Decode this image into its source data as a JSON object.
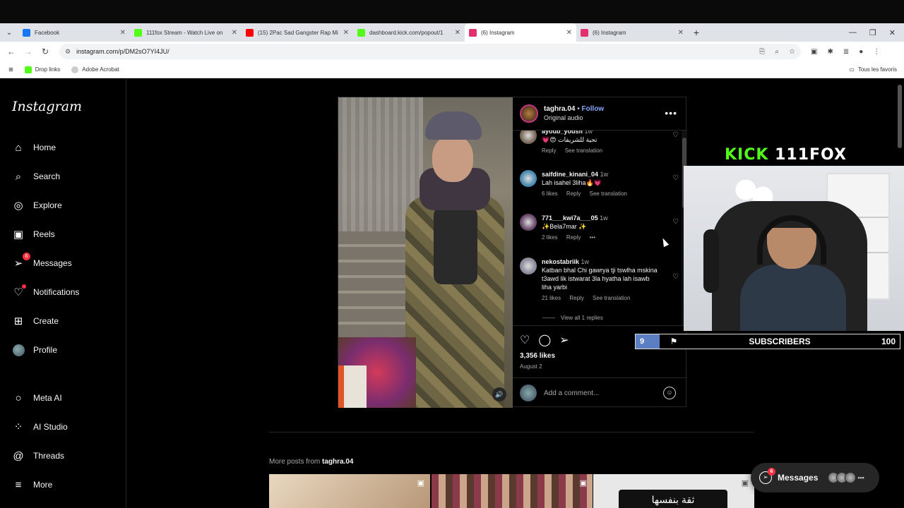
{
  "browser": {
    "tabs": [
      {
        "title": "Facebook",
        "color": "#1877f2",
        "active": false
      },
      {
        "title": "111fox Stream - Watch Live on",
        "color": "#53fc18",
        "active": false
      },
      {
        "title": "(15) 2Pac Sad Gangster Rap Mi",
        "color": "#ff0000",
        "active": false
      },
      {
        "title": "dashboard.kick.com/popout/1",
        "color": "#53fc18",
        "active": false
      },
      {
        "title": "(6) Instagram",
        "color": "#e1306c",
        "active": true
      },
      {
        "title": "(6) Instagram",
        "color": "#e1306c",
        "active": false
      }
    ],
    "url": "instagram.com/p/DM2sO7YI4JU/",
    "bookmarks": [
      {
        "label": "Drop links",
        "color": "#53fc18"
      },
      {
        "label": "Adobe Acrobat",
        "color": "#d9534f"
      }
    ],
    "all_bookmarks": "Tous les favoris"
  },
  "sidebar": {
    "logo": "Instagram",
    "items": [
      {
        "label": "Home",
        "icon": "⌂"
      },
      {
        "label": "Search",
        "icon": "⌕"
      },
      {
        "label": "Explore",
        "icon": "◎"
      },
      {
        "label": "Reels",
        "icon": "▣"
      },
      {
        "label": "Messages",
        "icon": "➢",
        "badge": "6"
      },
      {
        "label": "Notifications",
        "icon": "♡"
      },
      {
        "label": "Create",
        "icon": "⊞"
      },
      {
        "label": "Profile",
        "icon": ""
      },
      {
        "label": "Meta AI",
        "icon": "○"
      },
      {
        "label": "AI Studio",
        "icon": "⁘"
      },
      {
        "label": "Threads",
        "icon": "@"
      },
      {
        "label": "More",
        "icon": "≡"
      }
    ]
  },
  "post": {
    "username": "taghra.04",
    "follow": "Follow",
    "separator": "•",
    "audio": "Original audio",
    "comments": [
      {
        "user": "ayoub_yousfi",
        "time": "1w",
        "text": "💗😍 تحية للشريفات",
        "likes": "",
        "reply": "Reply",
        "translate": "See translation",
        "avatar": "#7a6a5a"
      },
      {
        "user": "saifdine_kinani_04",
        "time": "1w",
        "text": "Lah isahel 3liha🔥💗",
        "likes": "6 likes",
        "reply": "Reply",
        "translate": "See translation",
        "avatar": "#4a8ab0"
      },
      {
        "user": "771___kwi7a___05",
        "time": "1w",
        "text": "✨Bela7mar ✨",
        "likes": "2 likes",
        "reply": "Reply",
        "translate": "•••",
        "avatar": "#6a4a6a"
      },
      {
        "user": "nekostabriik",
        "time": "1w",
        "text": "Katban bhal Chi gawrya tji tswlha mskina t3awd lik istwarat 3la hyatha lah isawb liha yarbi",
        "likes": "21 likes",
        "reply": "Reply",
        "translate": "See translation",
        "avatar": "#8a8a9a"
      }
    ],
    "view_replies": "View all 1 replies",
    "likes": "3,356 likes",
    "date": "August 2",
    "add_comment": "Add a comment..."
  },
  "more_posts": {
    "prefix": "More posts from",
    "user": "taghra.04",
    "thumb3_text": "ثقة بنفسها"
  },
  "overlay": {
    "kick": "KICK",
    "channel": "111FOX",
    "subs_current": "9",
    "subs_label": "SUBSCRIBERS",
    "subs_goal": "100",
    "sub_fill_fraction": 0.09,
    "subs_bar_color": "#5b7fc2"
  },
  "messages_pill": {
    "label": "Messages",
    "badge": "6"
  }
}
